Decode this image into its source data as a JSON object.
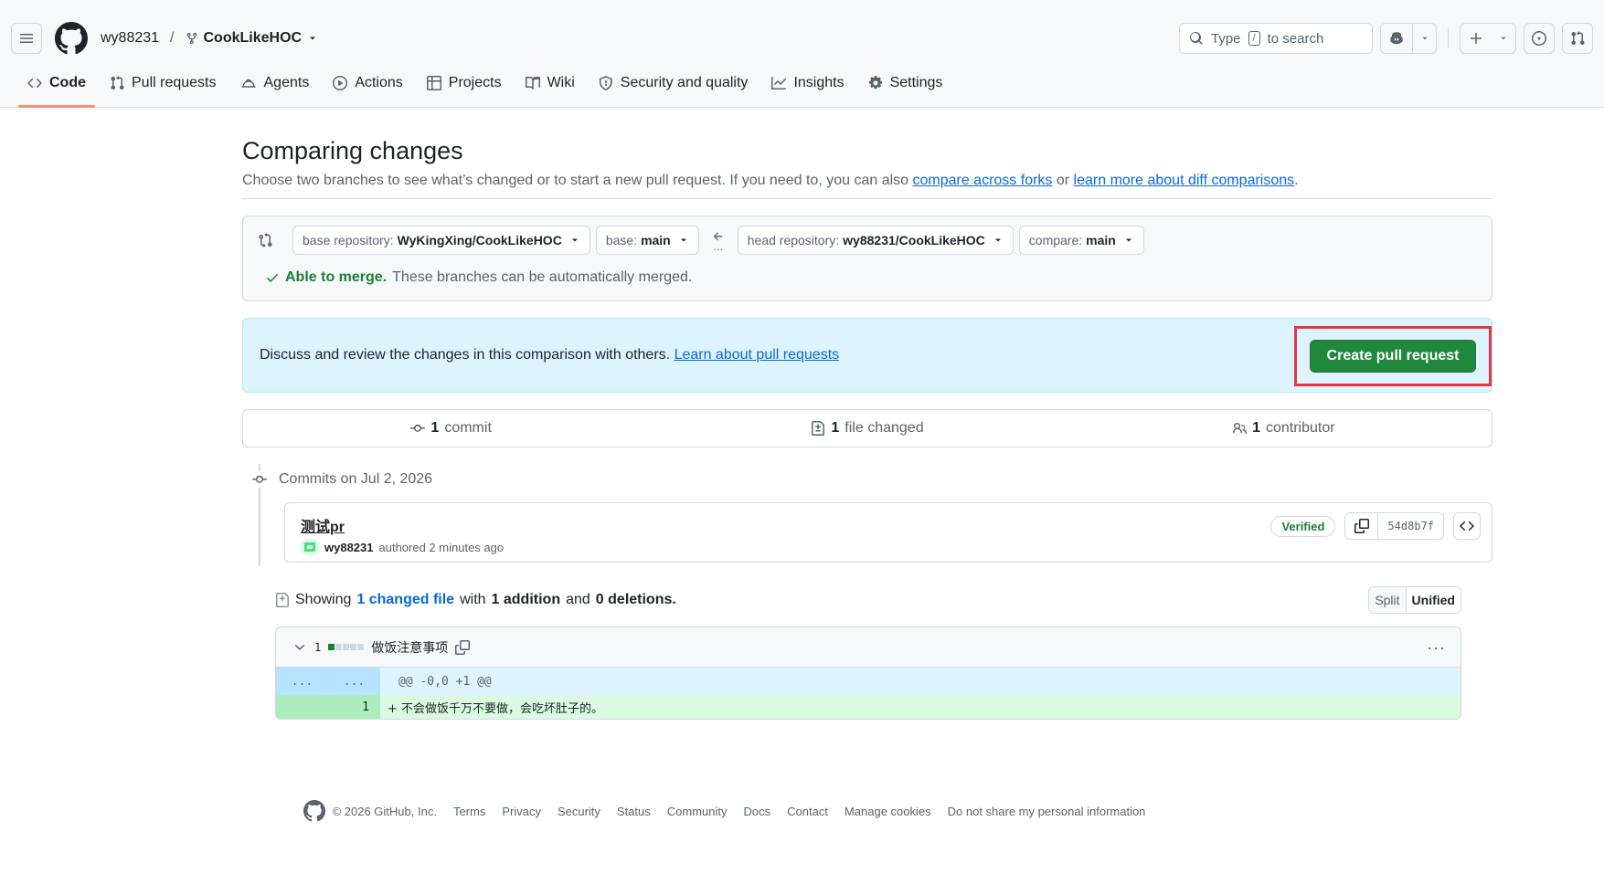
{
  "header": {
    "owner": "wy88231",
    "separator": "/",
    "repo": "CookLikeHOC",
    "search_prefix": "Type",
    "search_key": "/",
    "search_suffix": "to search"
  },
  "tabs": [
    {
      "label": "Code"
    },
    {
      "label": "Pull requests"
    },
    {
      "label": "Agents"
    },
    {
      "label": "Actions"
    },
    {
      "label": "Projects"
    },
    {
      "label": "Wiki"
    },
    {
      "label": "Security and quality"
    },
    {
      "label": "Insights"
    },
    {
      "label": "Settings"
    }
  ],
  "page": {
    "title": "Comparing changes",
    "subtitle_text": "Choose two branches to see what’s changed or to start a new pull request. If you need to, you can also ",
    "link_forks": "compare across forks",
    "subtitle_or": " or ",
    "link_learn": "learn more about diff comparisons",
    "subtitle_end": "."
  },
  "range": {
    "base_repo_label": "base repository:",
    "base_repo_value": "WyKingXing/CookLikeHOC",
    "base_label": "base:",
    "base_value": "main",
    "head_repo_label": "head repository:",
    "head_repo_value": "wy88231/CookLikeHOC",
    "compare_label": "compare:",
    "compare_value": "main",
    "merge_ok": "Able to merge.",
    "merge_text": "These branches can be automatically merged."
  },
  "info": {
    "text": "Discuss and review the changes in this comparison with others. ",
    "link": "Learn about pull requests",
    "button": "Create pull request"
  },
  "stats": {
    "commits_n": "1",
    "commits_label": "commit",
    "files_n": "1",
    "files_label": "file changed",
    "contrib_n": "1",
    "contrib_label": "contributor"
  },
  "timeline": {
    "heading": "Commits on Jul 2, 2026",
    "commit_title": "测试pr",
    "author": "wy88231",
    "authored": "authored 2 minutes ago",
    "verified": "Verified",
    "sha": "54d8b7f"
  },
  "diffsummary": {
    "showing": "Showing",
    "changed_link": "1 changed file",
    "with": "with",
    "additions": "1 addition",
    "and": "and",
    "deletions": "0 deletions",
    "end": ".",
    "split": "Split",
    "unified": "Unified"
  },
  "file": {
    "count": "1",
    "name": "做饭注意事项",
    "hunk_l": "...",
    "hunk_r": "...",
    "hunk_text": "@@ -0,0 +1 @@",
    "add_ln": "1",
    "add_text": "+ 不会做饭千万不要做，会吃坏肚子的。"
  },
  "footer": {
    "copyright": "© 2026 GitHub, Inc.",
    "links": [
      "Terms",
      "Privacy",
      "Security",
      "Status",
      "Community",
      "Docs",
      "Contact",
      "Manage cookies",
      "Do not share my personal information"
    ]
  }
}
